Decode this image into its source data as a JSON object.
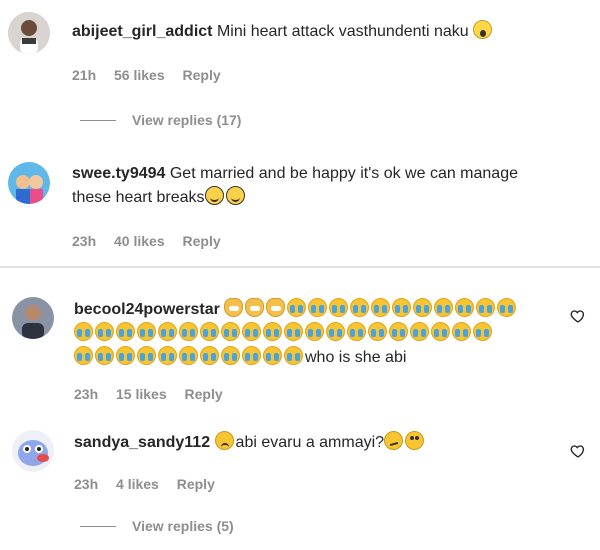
{
  "comments": [
    {
      "username": "abijeet_girl_addict",
      "text": "Mini heart attack vasthundenti naku",
      "emojis_after": [
        "scream"
      ],
      "time": "21h",
      "likes": "56 likes",
      "reply": "Reply",
      "view_replies": "View replies (17)"
    },
    {
      "username": "swee.ty9494",
      "text_line1": "Get married and be happy it's ok we can manage",
      "text_line2": "these heart breaks",
      "emojis_after": [
        "smile",
        "smile"
      ],
      "time": "23h",
      "likes": "40 likes",
      "reply": "Reply"
    },
    {
      "username": "becool24powerstar",
      "emojis_line1": [
        "cat",
        "cat",
        "cat",
        "cry",
        "cry",
        "cry",
        "cry",
        "cry",
        "cry",
        "cry",
        "cry",
        "cry",
        "cry",
        "cry"
      ],
      "emojis_line2": [
        "cry",
        "cry",
        "cry",
        "cry",
        "cry",
        "cry",
        "cry",
        "cry",
        "cry",
        "cry",
        "cry",
        "cry",
        "cry",
        "cry",
        "cry",
        "cry",
        "cry",
        "cry",
        "cry",
        "cry"
      ],
      "emojis_line3": [
        "cry",
        "cry",
        "cry",
        "cry",
        "cry",
        "cry",
        "cry",
        "cry",
        "cry",
        "cry",
        "cry"
      ],
      "text_end": "who is she abi",
      "time": "23h",
      "likes": "15 likes",
      "reply": "Reply"
    },
    {
      "username": "sandya_sandy112",
      "emoji_before": [
        "sad"
      ],
      "text": "abi evaru a ammayi?",
      "emojis_after": [
        "confused",
        "roll"
      ],
      "time": "23h",
      "likes": "4 likes",
      "reply": "Reply",
      "view_replies": "View replies (5)"
    }
  ],
  "icons": {
    "heart": "heart-outline-icon"
  },
  "colors": {
    "text": "#262626",
    "secondary": "#8e8e8e",
    "divider": "#e2e2e2"
  }
}
